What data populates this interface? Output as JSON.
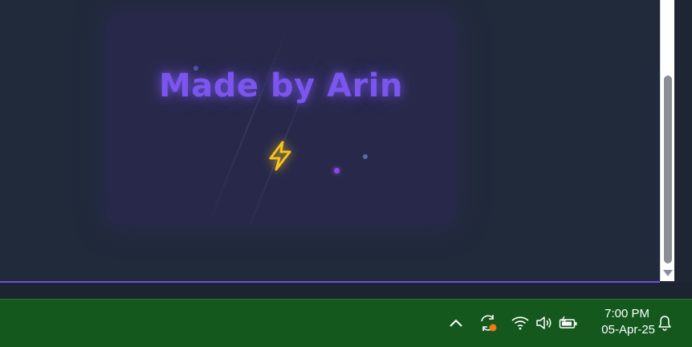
{
  "card": {
    "title": "Made by Arin",
    "icon": "lightning-bolt-icon",
    "title_color": "#7a55ee",
    "icon_color": "#f5c518"
  },
  "window": {
    "accent_border_color": "#6d4fe0",
    "background_color": "#212a3b"
  },
  "taskbar": {
    "background_color": "#14581d",
    "tray_icons": [
      "chevron-up-icon",
      "sync-icon",
      "wifi-icon",
      "volume-icon",
      "battery-icon"
    ],
    "time": "7:00 PM",
    "date": "05-Apr-25",
    "notification_icon": "bell-icon"
  }
}
